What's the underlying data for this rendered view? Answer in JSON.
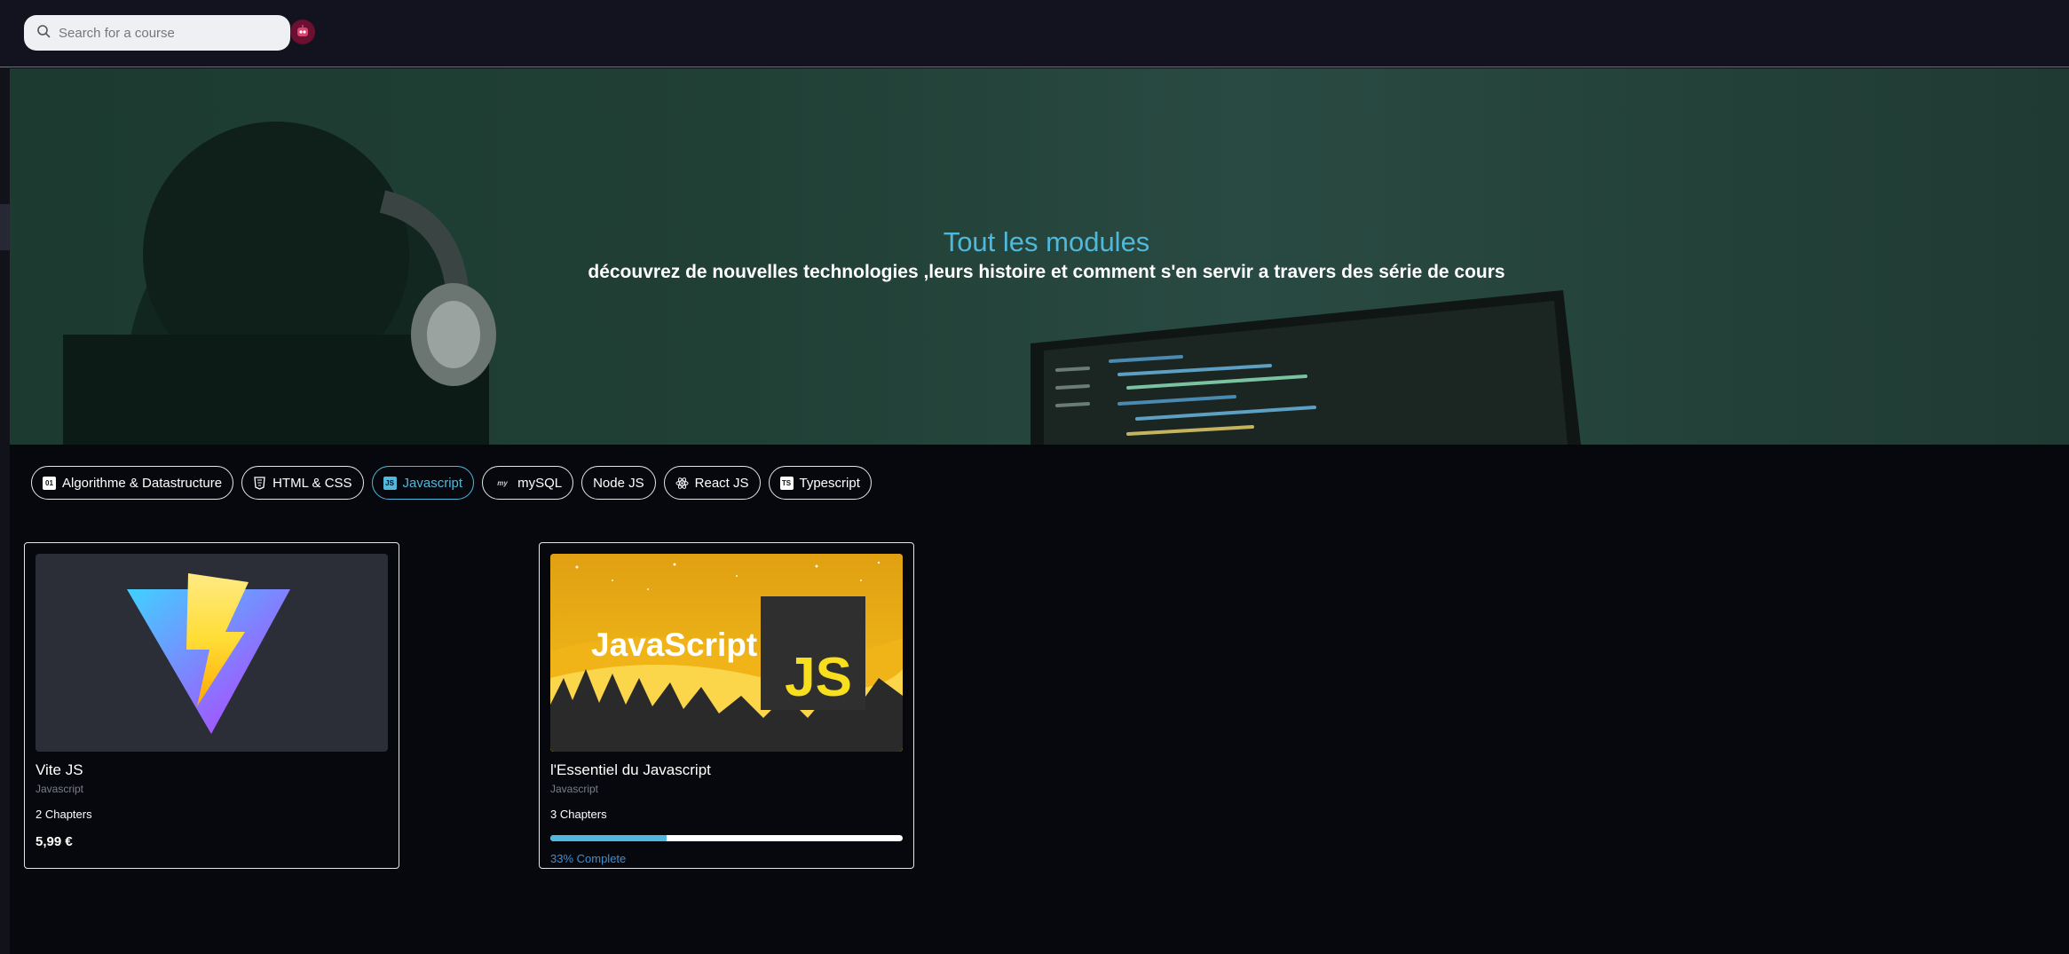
{
  "search": {
    "placeholder": "Search for a course"
  },
  "hero": {
    "title": "Tout les modules",
    "subtitle": "découvrez de nouvelles technologies ,leurs histoire et comment s'en servir a travers des série de cours"
  },
  "filters": [
    {
      "label": "Algorithme & Datastructure",
      "icon": "algorithm-icon",
      "active": false
    },
    {
      "label": "HTML & CSS",
      "icon": "html5-icon",
      "active": false
    },
    {
      "label": "Javascript",
      "icon": "javascript-icon",
      "active": true
    },
    {
      "label": "mySQL",
      "icon": "mysql-icon",
      "active": false
    },
    {
      "label": "Node JS",
      "icon": "",
      "active": false
    },
    {
      "label": "React JS",
      "icon": "react-icon",
      "active": false
    },
    {
      "label": "Typescript",
      "icon": "typescript-icon",
      "active": false
    }
  ],
  "courses": [
    {
      "title": "Vite JS",
      "category": "Javascript",
      "chapters": "2 Chapters",
      "price": "5,99 €",
      "thumbnail_icon": "vite-logo-icon"
    },
    {
      "title": "l'Essentiel du Javascript",
      "category": "Javascript",
      "chapters": "3 Chapters",
      "progress": 0.33,
      "progress_label": "33% Complete",
      "thumbnail_text": "JavaScript",
      "thumbnail_badge": "JS",
      "thumbnail_icon": "javascript-banner-icon"
    }
  ],
  "colors": {
    "accent": "#4fb8dc",
    "background": "#07080d",
    "topbar": "#12131f",
    "progress_label": "#3d8fd1"
  }
}
